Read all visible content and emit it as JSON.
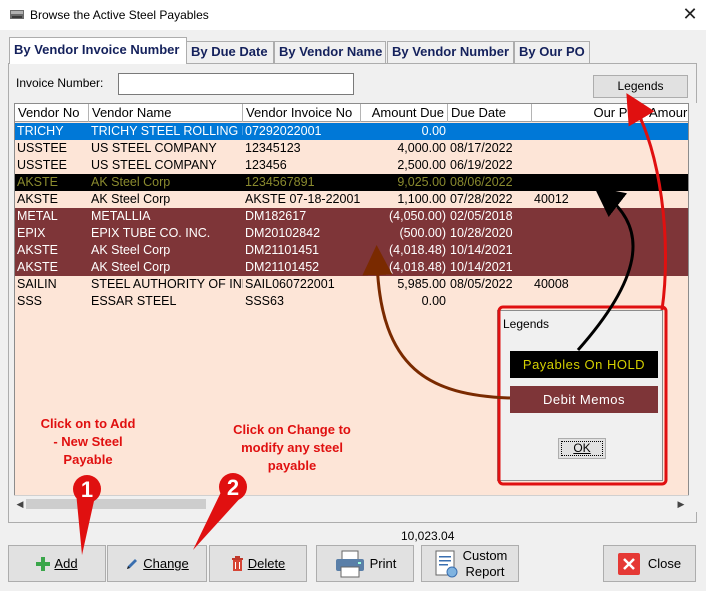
{
  "window": {
    "title": "Browse the Active Steel Payables",
    "close_glyph": "✕"
  },
  "tabs": [
    {
      "label": "By Vendor Invoice Number",
      "active": true
    },
    {
      "label": "By Due Date",
      "active": false
    },
    {
      "label": "By Vendor Name",
      "active": false
    },
    {
      "label": "By Vendor Number",
      "active": false
    },
    {
      "label": "By Our PO",
      "active": false
    }
  ],
  "search": {
    "label": "Invoice Number:",
    "value": ""
  },
  "legends_button": "Legends",
  "grid": {
    "columns": [
      "Vendor No",
      "Vendor Name",
      "Vendor Invoice No",
      "Amount Due",
      "Due Date",
      "Our PO",
      "Amour"
    ],
    "rows": [
      {
        "style": "selected",
        "cells": [
          "TRICHY",
          "TRICHY STEEL ROLLING MILL",
          "07292022001",
          "0.00",
          "",
          "",
          ""
        ]
      },
      {
        "style": "normal",
        "cells": [
          "USSTEE",
          "US STEEL COMPANY",
          "12345123",
          "4,000.00",
          "08/17/2022",
          "",
          ""
        ]
      },
      {
        "style": "normal",
        "cells": [
          "USSTEE",
          "US STEEL COMPANY",
          "123456",
          "2,500.00",
          "06/19/2022",
          "",
          ""
        ]
      },
      {
        "style": "hold",
        "cells": [
          "AKSTE",
          "AK Steel Corp",
          "1234567891",
          "9,025.00",
          "08/06/2022",
          "",
          ""
        ]
      },
      {
        "style": "normal",
        "cells": [
          "AKSTE",
          "AK Steel Corp",
          "AKSTE 07-18-22001",
          "1,100.00",
          "07/28/2022",
          "40012",
          ""
        ]
      },
      {
        "style": "debit",
        "cells": [
          "METAL",
          "METALLIA",
          "DM182617",
          "(4,050.00)",
          "02/05/2018",
          "",
          ""
        ]
      },
      {
        "style": "debit",
        "cells": [
          "EPIX",
          "EPIX TUBE CO. INC.",
          "DM20102842",
          "(500.00)",
          "10/28/2020",
          "",
          ""
        ]
      },
      {
        "style": "debit",
        "cells": [
          "AKSTE",
          "AK Steel Corp",
          "DM21101451",
          "(4,018.48)",
          "10/14/2021",
          "",
          ""
        ]
      },
      {
        "style": "debit",
        "cells": [
          "AKSTE",
          "AK Steel Corp",
          "DM21101452",
          "(4,018.48)",
          "10/14/2021",
          "",
          ""
        ]
      },
      {
        "style": "normal",
        "cells": [
          "SAILIN",
          "STEEL AUTHORITY OF INDIA",
          "SAIL060722001",
          "5,985.00",
          "08/05/2022",
          "40008",
          ""
        ]
      },
      {
        "style": "normal",
        "cells": [
          "SSS",
          "ESSAR STEEL",
          "SSS63",
          "0.00",
          "",
          "",
          ""
        ]
      }
    ]
  },
  "total": "10,023.04",
  "buttons": {
    "add": "Add",
    "change": "Change",
    "delete": "Delete",
    "print": "Print",
    "custom_report_1": "Custom",
    "custom_report_2": "Report",
    "close": "Close"
  },
  "legends_dialog": {
    "title": "Legends",
    "hold": "Payables On HOLD",
    "debit": "Debit Memos",
    "ok": "OK"
  },
  "annotations": {
    "add_note": "Click on to Add - New Steel Payable",
    "change_note": "Click on Change to modify any steel payable",
    "badge_1": "1",
    "badge_2": "2"
  },
  "colors": {
    "selected_row": "#0078d7",
    "hold_row_bg": "#000000",
    "hold_row_text": "#8a8a2e",
    "debit_row_bg": "#7e3538",
    "grid_bg": "#fde5d7",
    "annotation_red": "#e01010",
    "arrow_brown": "#7a2a00"
  }
}
